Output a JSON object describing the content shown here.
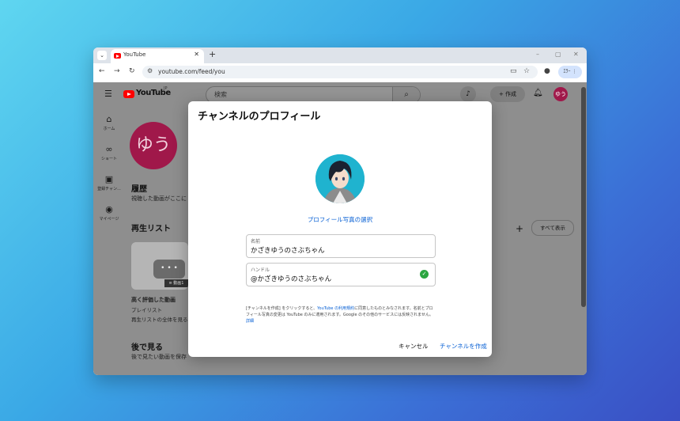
{
  "browser": {
    "tab_title": "YouTube",
    "tab_close": "✕",
    "new_tab": "+",
    "url": "youtube.com/feed/you",
    "error_button": "ｴﾗｰ ⋮",
    "window_controls": {
      "minimize": "–",
      "maximize": "▢",
      "close": "✕"
    }
  },
  "youtube": {
    "logo_text": "YouTube",
    "logo_region": "JP",
    "search_placeholder": "検索",
    "create_label": "+ 作成",
    "avatar_initial": "ゆう",
    "sidebar": [
      {
        "label": "ホーム",
        "icon": "home-icon"
      },
      {
        "label": "ショート",
        "icon": "shorts-icon"
      },
      {
        "label": "登録チャン...",
        "icon": "subscriptions-icon"
      },
      {
        "label": "マイページ",
        "icon": "you-icon"
      }
    ],
    "profile_initial": "ゆう",
    "history": {
      "title": "履歴",
      "subtitle": "視聴した動画がここに"
    },
    "playlists": {
      "title": "再生リスト",
      "show_all": "すべて表示",
      "item_title": "高く評価した動画",
      "item_type": "プレイリスト",
      "item_link": "再生リストの全体を見る",
      "thumb_badge": "≡ 動画1"
    },
    "watch_later": {
      "title": "後で見る",
      "subtitle": "後で見たい動画を保存"
    }
  },
  "modal": {
    "title": "チャンネルのプロフィール",
    "select_photo": "プロフィール写真の選択",
    "name_label": "名前",
    "name_value": "かざきゆうのさぶちゃん",
    "handle_label": "ハンドル",
    "handle_value": "@かざきゆうのさぶちゃん",
    "terms_pre": "[チャンネルを作成] をクリックすると、",
    "terms_link": "YouTube の利用規約",
    "terms_post": "に同意したものとみなされます。名前とプロフィール写真の変更は YouTube のみに適用されます。Google のその他のサービスには反映されません。",
    "terms_details": "詳細",
    "cancel_label": "キャンセル",
    "create_label": "チャンネルを作成"
  }
}
